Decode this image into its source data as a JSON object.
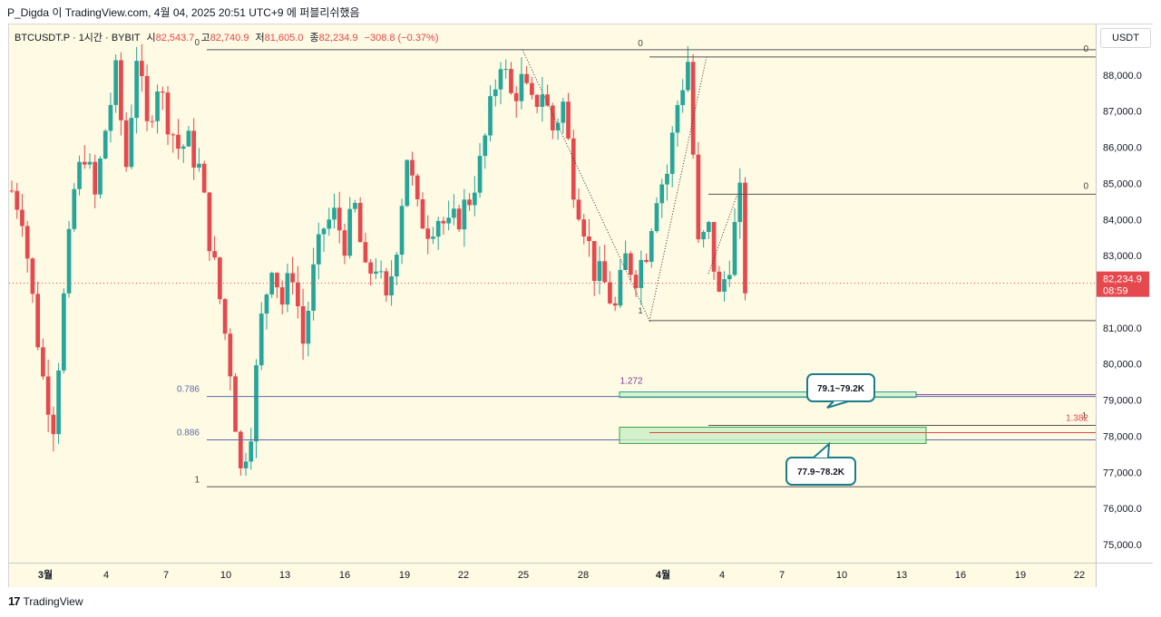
{
  "caption": "P_Digda 이 TradingView.com, 4월 04, 2025 20:51 UTC+9 에 퍼블리쉬했음",
  "legend": {
    "symbol": "BTCUSDT.P · 1시간 · BYBIT",
    "open_label": "시",
    "open": "82,543.7",
    "high_label": "고",
    "high": "82,740.9",
    "low_label": "저",
    "low": "81,605.0",
    "close_label": "종",
    "close": "82,234.9",
    "change": "−308.8 (−0.37%)"
  },
  "currency_button": "USDT",
  "price_tag": {
    "price": "82,234.9",
    "countdown": "08:59",
    "color": "#e5484d"
  },
  "brand": "TradingView",
  "colors": {
    "up": "#26a69a",
    "down": "#e5484d",
    "background": "#fefae3",
    "fib": "#5b6aa8",
    "box_blue_green": "#16a085",
    "box_green": "#c8efc4"
  },
  "chart_data": {
    "type": "candlestick",
    "timeframe": "1시간",
    "ylim": [
      74500,
      89400
    ],
    "y_ticks": [
      "75,000.0",
      "76,000.0",
      "77,000.0",
      "78,000.0",
      "79,000.0",
      "80,000.0",
      "81,000.0",
      "82,000.0",
      "83,000.0",
      "84,000.0",
      "85,000.0",
      "86,000.0",
      "87,000.0",
      "88,000.0",
      "89,000.0"
    ],
    "x_ticks": [
      "3월",
      "4",
      "7",
      "10",
      "13",
      "16",
      "19",
      "22",
      "25",
      "28",
      "4월",
      "4",
      "7",
      "10",
      "13",
      "16",
      "19",
      "22"
    ],
    "price_path": [
      [
        0,
        84800
      ],
      [
        2,
        84200
      ],
      [
        4,
        81800
      ],
      [
        6,
        79600
      ],
      [
        8,
        78400
      ],
      [
        10,
        81800
      ],
      [
        12,
        84800
      ],
      [
        14,
        85900
      ],
      [
        16,
        84600
      ],
      [
        18,
        86500
      ],
      [
        20,
        88000
      ],
      [
        22,
        85500
      ],
      [
        24,
        88600
      ],
      [
        26,
        86500
      ],
      [
        28,
        87800
      ],
      [
        30,
        86800
      ],
      [
        32,
        86000
      ],
      [
        34,
        86100
      ],
      [
        36,
        85400
      ],
      [
        38,
        83500
      ],
      [
        40,
        81800
      ],
      [
        42,
        79900
      ],
      [
        44,
        77000
      ],
      [
        46,
        78300
      ],
      [
        48,
        81200
      ],
      [
        50,
        82900
      ],
      [
        52,
        81700
      ],
      [
        54,
        82600
      ],
      [
        56,
        80600
      ],
      [
        58,
        82500
      ],
      [
        60,
        83800
      ],
      [
        62,
        84100
      ],
      [
        64,
        83400
      ],
      [
        66,
        84300
      ],
      [
        68,
        82400
      ],
      [
        70,
        82800
      ],
      [
        72,
        81600
      ],
      [
        74,
        83400
      ],
      [
        76,
        85800
      ],
      [
        78,
        84200
      ],
      [
        80,
        83800
      ],
      [
        82,
        84100
      ],
      [
        84,
        83700
      ],
      [
        86,
        84100
      ],
      [
        88,
        84600
      ],
      [
        90,
        85500
      ],
      [
        92,
        87000
      ],
      [
        94,
        88500
      ],
      [
        96,
        87400
      ],
      [
        98,
        87800
      ],
      [
        100,
        87100
      ],
      [
        102,
        87600
      ],
      [
        104,
        86500
      ],
      [
        106,
        87200
      ],
      [
        108,
        85000
      ],
      [
        110,
        83900
      ],
      [
        112,
        82600
      ],
      [
        114,
        82200
      ],
      [
        116,
        81500
      ],
      [
        118,
        82900
      ],
      [
        120,
        82500
      ],
      [
        122,
        83200
      ],
      [
        124,
        84800
      ],
      [
        126,
        85300
      ],
      [
        128,
        87200
      ],
      [
        130,
        88400
      ],
      [
        132,
        83200
      ],
      [
        134,
        83700
      ],
      [
        136,
        81800
      ],
      [
        138,
        82900
      ],
      [
        140,
        84600
      ],
      [
        141,
        82200
      ]
    ],
    "last_price": 82234.9,
    "fib_levels": [
      {
        "label": "0",
        "value": 88700
      },
      {
        "label": "0.786",
        "value": 79100
      },
      {
        "label": "0.886",
        "value": 77900
      },
      {
        "label": "1",
        "value": 76600
      }
    ],
    "extension_lines": [
      {
        "label": "0",
        "value": 88500
      },
      {
        "label": "0",
        "value": 84700
      },
      {
        "label": "",
        "value": 81200
      }
    ],
    "markers": [
      "1.272",
      "1.382",
      "1",
      "1"
    ],
    "zones": [
      {
        "label": "79.1~79.2K",
        "low": 79100,
        "high": 79200
      },
      {
        "label": "77.9~78.2K",
        "low": 77900,
        "high": 78200
      }
    ]
  }
}
